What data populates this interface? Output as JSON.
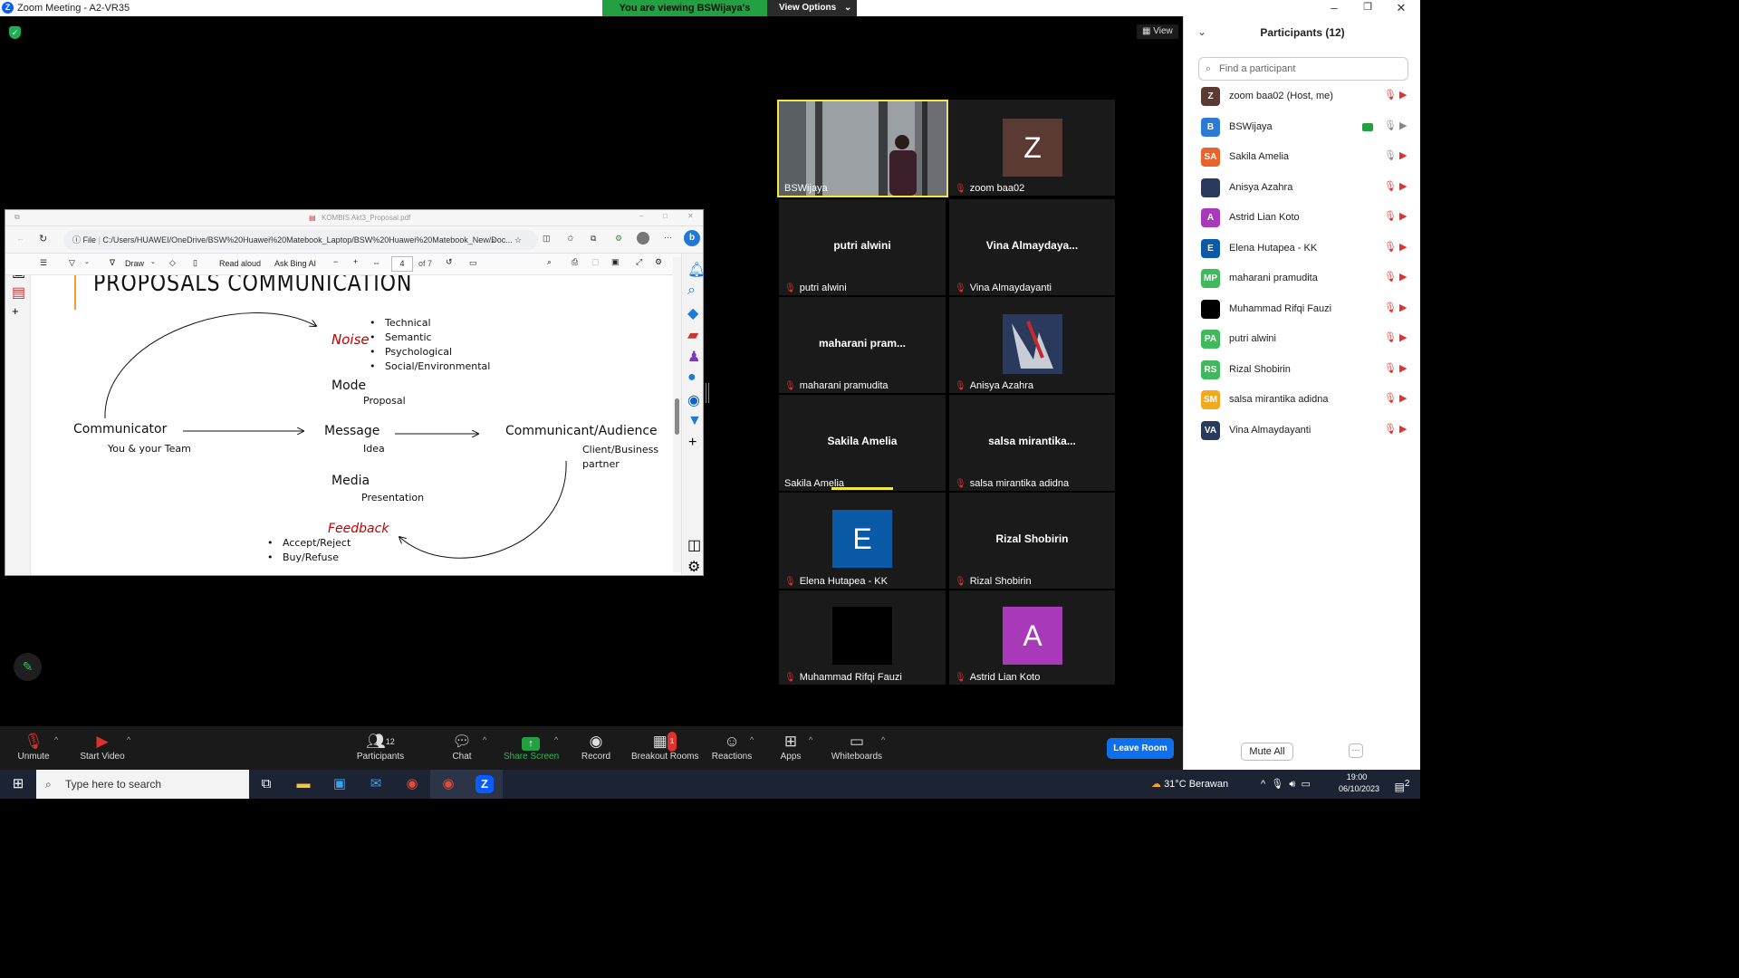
{
  "window": {
    "title": "Zoom Meeting - A2-VR35"
  },
  "banner": {
    "viewing": "You are viewing BSWijaya's screen",
    "view_options": "View Options"
  },
  "stage": {
    "view_label": "View"
  },
  "browser": {
    "tab_title": "KOMBIS Akt3_Proposal.pdf",
    "file_label": "File",
    "url": "C:/Users/HUAWEI/OneDrive/BSW%20Huawei%20Matebook_Laptop/BSW%20Huawei%20Matebook_New/Doc...",
    "toolbar": {
      "draw": "Draw",
      "read_aloud": "Read aloud",
      "ask_bing": "Ask Bing AI",
      "page_num": "4",
      "page_total": "of 7"
    }
  },
  "slide": {
    "title": "PROPOSALS COMMUNICATION",
    "noise": "Noise",
    "noise_items": [
      "Technical",
      "Semantic",
      "Psychological",
      "Social/Environmental"
    ],
    "mode": "Mode",
    "mode_sub": "Proposal",
    "communicator": "Communicator",
    "communicator_sub": "You & your Team",
    "message": "Message",
    "message_sub": "Idea",
    "audience": "Communicant/Audience",
    "audience_sub1": "Client/Business",
    "audience_sub2": "partner",
    "media": "Media",
    "media_sub": "Presentation",
    "feedback": "Feedback",
    "feedback_items": [
      "Accept/Reject",
      "Buy/Refuse"
    ]
  },
  "tiles": [
    {
      "name": "BSWijaya",
      "type": "video"
    },
    {
      "name": "zoom baa02",
      "type": "avatar",
      "letter": "Z",
      "color": "#5a3a32"
    },
    {
      "name": "putri alwini",
      "type": "text",
      "big": "putri alwini"
    },
    {
      "name": "Vina Almaydayanti",
      "type": "text",
      "big": "Vina  Almaydaya..."
    },
    {
      "name": "maharani pramudita",
      "type": "text",
      "big": "maharani  pram..."
    },
    {
      "name": "Anisya Azahra",
      "type": "photo"
    },
    {
      "name": "Sakila Amelia",
      "type": "text",
      "big": "Sakila Amelia"
    },
    {
      "name": "salsa mirantika adidna",
      "type": "text",
      "big": "salsa  mirantika..."
    },
    {
      "name": "Elena Hutapea - KK",
      "type": "avatar",
      "letter": "E",
      "color": "#0a5aa8"
    },
    {
      "name": "Rizal Shobirin",
      "type": "text",
      "big": "Rizal Shobirin"
    },
    {
      "name": "Muhammad Rifqi Fauzi",
      "type": "avatar",
      "letter": "",
      "color": "#000000"
    },
    {
      "name": "Astrid Lian Koto",
      "type": "avatar",
      "letter": "A",
      "color": "#a839b8"
    }
  ],
  "participants": {
    "title": "Participants (12)",
    "search_placeholder": "Find a participant",
    "list": [
      {
        "initials": "Z",
        "name": "zoom baa02 (Host, me)",
        "color": "#5a3a32"
      },
      {
        "initials": "B",
        "name": "BSWijaya",
        "color": "#2d79d6"
      },
      {
        "initials": "SA",
        "name": "Sakila Amelia",
        "color": "#e8642c"
      },
      {
        "initials": "",
        "name": "Anisya Azahra",
        "color": "#2a3a5c"
      },
      {
        "initials": "A",
        "name": "Astrid Lian Koto",
        "color": "#a839b8"
      },
      {
        "initials": "E",
        "name": "Elena Hutapea - KK",
        "color": "#0a5aa8"
      },
      {
        "initials": "MP",
        "name": "maharani pramudita",
        "color": "#3fb95b"
      },
      {
        "initials": "",
        "name": "Muhammad Rifqi Fauzi",
        "color": "#000000"
      },
      {
        "initials": "PA",
        "name": "putri alwini",
        "color": "#3fb95b"
      },
      {
        "initials": "RS",
        "name": "Rizal Shobirin",
        "color": "#3fb95b"
      },
      {
        "initials": "SM",
        "name": "salsa mirantika adidna",
        "color": "#f2a91c"
      },
      {
        "initials": "VA",
        "name": "Vina Almaydayanti",
        "color": "#2a3a5c"
      }
    ],
    "mute_all": "Mute All",
    "more": "···"
  },
  "toolbar": {
    "unmute": "Unmute",
    "start_video": "Start Video",
    "participants": "Participants",
    "participants_count": "12",
    "chat": "Chat",
    "share_screen": "Share Screen",
    "record": "Record",
    "breakout": "Breakout Rooms",
    "breakout_badge": "1",
    "reactions": "Reactions",
    "apps": "Apps",
    "whiteboards": "Whiteboards",
    "leave": "Leave Room"
  },
  "taskbar": {
    "search_placeholder": "Type here to search",
    "weather": "31°C  Berawan",
    "time": "19:00",
    "date": "06/10/2023",
    "notif": "2"
  }
}
